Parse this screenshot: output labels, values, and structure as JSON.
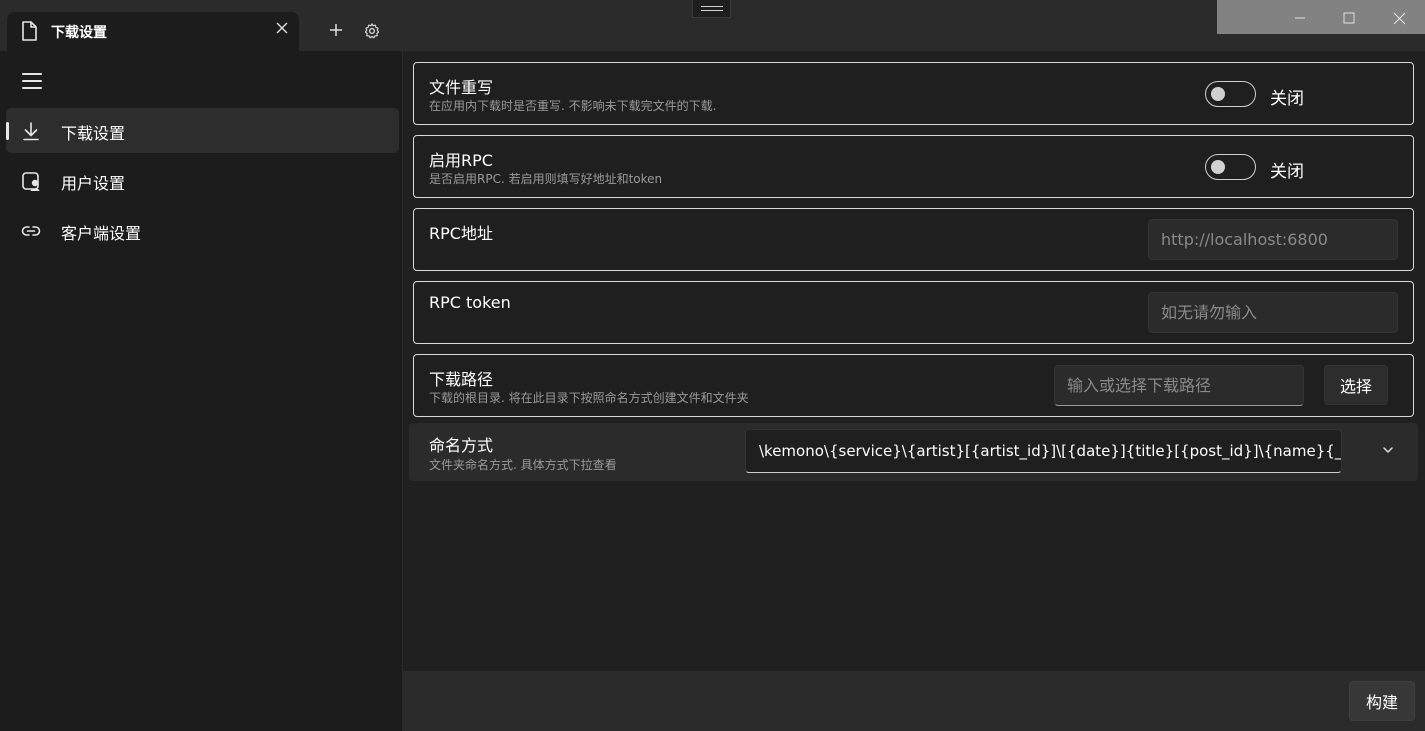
{
  "window": {
    "tab_title": "下载设置"
  },
  "sidebar": {
    "items": [
      {
        "label": "下载设置",
        "icon": "download-icon",
        "active": true
      },
      {
        "label": "用户设置",
        "icon": "user-card-icon",
        "active": false
      },
      {
        "label": "客户端设置",
        "icon": "link-icon",
        "active": false
      }
    ]
  },
  "settings": {
    "file_overwrite": {
      "title": "文件重写",
      "desc": "在应用内下载时是否重写. 不影响未下载完文件的下载.",
      "state_label": "关闭"
    },
    "enable_rpc": {
      "title": "启用RPC",
      "desc": "是否启用RPC. 若启用则填写好地址和token",
      "state_label": "关闭"
    },
    "rpc_address": {
      "title": "RPC地址",
      "placeholder": "http://localhost:6800"
    },
    "rpc_token": {
      "title": "RPC token",
      "placeholder": "如无请勿输入"
    },
    "download_path": {
      "title": "下载路径",
      "desc": "下载的根目录. 将在此目录下按照命名方式创建文件和文件夹",
      "placeholder": "输入或选择下载路径",
      "button_label": "选择"
    },
    "naming": {
      "title": "命名方式",
      "desc": "文件夹命名方式. 具体方式下拉查看",
      "value": "\\kemono\\{service}\\{artist}[{artist_id}]\\[{date}]{title}[{post_id}]\\{name}{_index}"
    }
  },
  "footer": {
    "build_label": "构建"
  },
  "colors": {
    "background": "#202020",
    "sidebar": "#1c1c1c",
    "card_border": "#d9d9d9",
    "text_secondary": "#9a9a9a"
  }
}
